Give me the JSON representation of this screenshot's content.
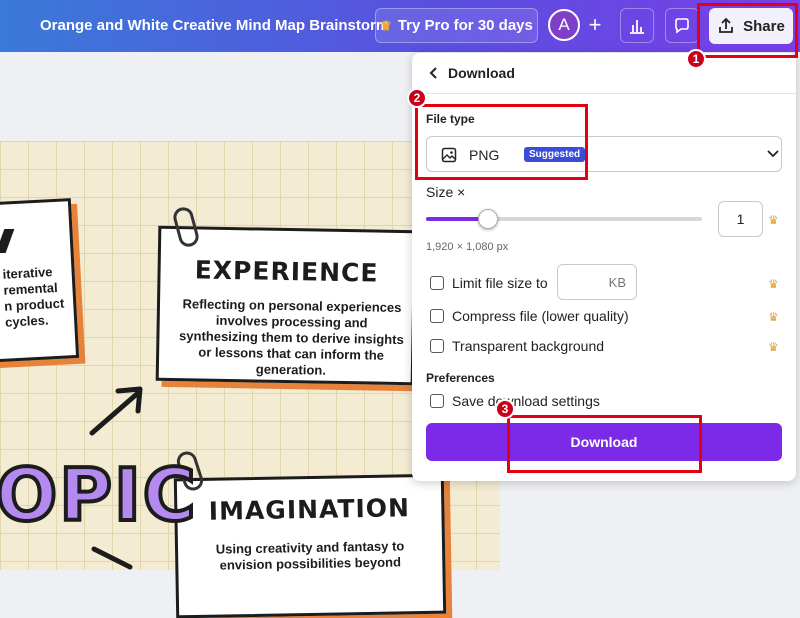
{
  "header": {
    "doc_title": "Orange and White Creative Mind Map Brainstorm",
    "try_pro_label": "Try Pro for 30 days",
    "avatar_initial": "A",
    "plus_label": "+",
    "share_label": "Share"
  },
  "annotations": [
    "1",
    "2",
    "3"
  ],
  "canvas": {
    "left_card_lines": [
      "iterative",
      "remental",
      "n product",
      "cycles."
    ],
    "experience_title": "EXPERIENCE",
    "experience_body": "Reflecting on personal experiences involves processing and synthesizing them to derive insights or lessons that can inform the generation.",
    "imagination_title": "IMAGINATION",
    "imagination_body": "Using creativity and fantasy to envision possibilities beyond",
    "topic_text": "OPIC"
  },
  "download_panel": {
    "back_title": "Download",
    "file_type_label": "File type",
    "file_type_value": "PNG",
    "suggested_badge": "Suggested",
    "size_label": "Size ×",
    "size_value": "1",
    "size_fraction": 0.22,
    "dimensions": "1,920 × 1,080 px",
    "limit_label": "Limit file size to",
    "kb_unit": "KB",
    "compress_label": "Compress file (lower quality)",
    "transparent_label": "Transparent background",
    "preferences_label": "Preferences",
    "save_settings_label": "Save download settings",
    "download_button": "Download",
    "accent_color": "#7d2ae8"
  }
}
